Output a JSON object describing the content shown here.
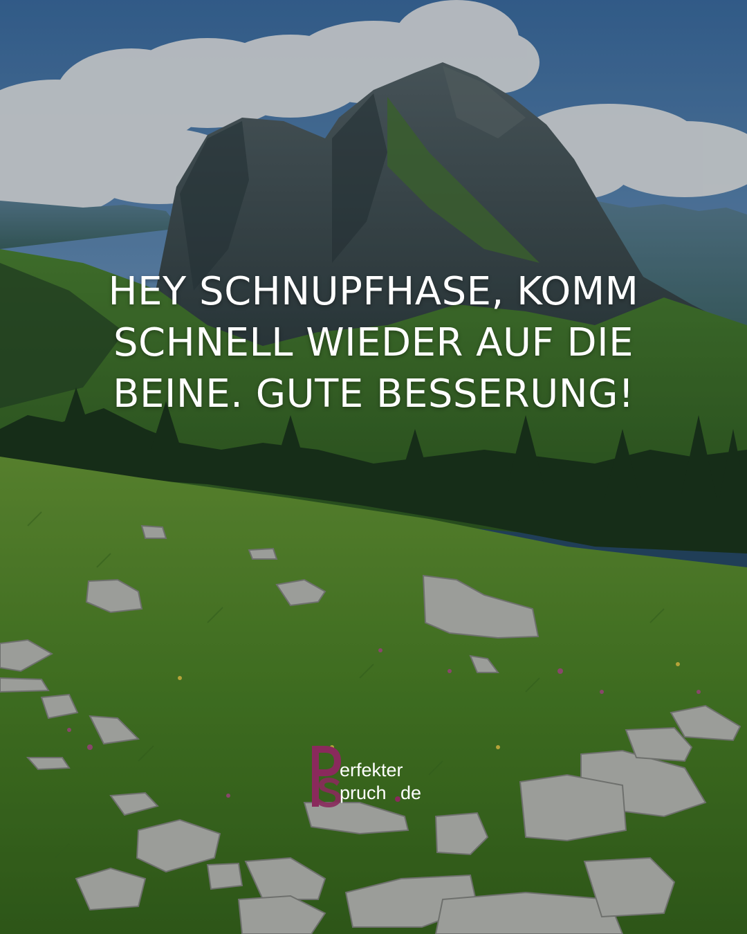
{
  "quote": {
    "lines": [
      "HEY SCHNUPFHASE, KOMM",
      "SCHNELL WIEDER AUF DIE",
      "BEINE. GUTE BESSERUNG!"
    ]
  },
  "logo": {
    "part1": "erfekter",
    "part2": "pruch",
    "part3": "de",
    "accent_color": "#8a2a5c"
  },
  "scene": {
    "sky_color": "#5f8fc0",
    "cloud_color": "#eef2f6",
    "rock_color": "#3b4c52",
    "meadow_color": "#4e8a2e"
  }
}
